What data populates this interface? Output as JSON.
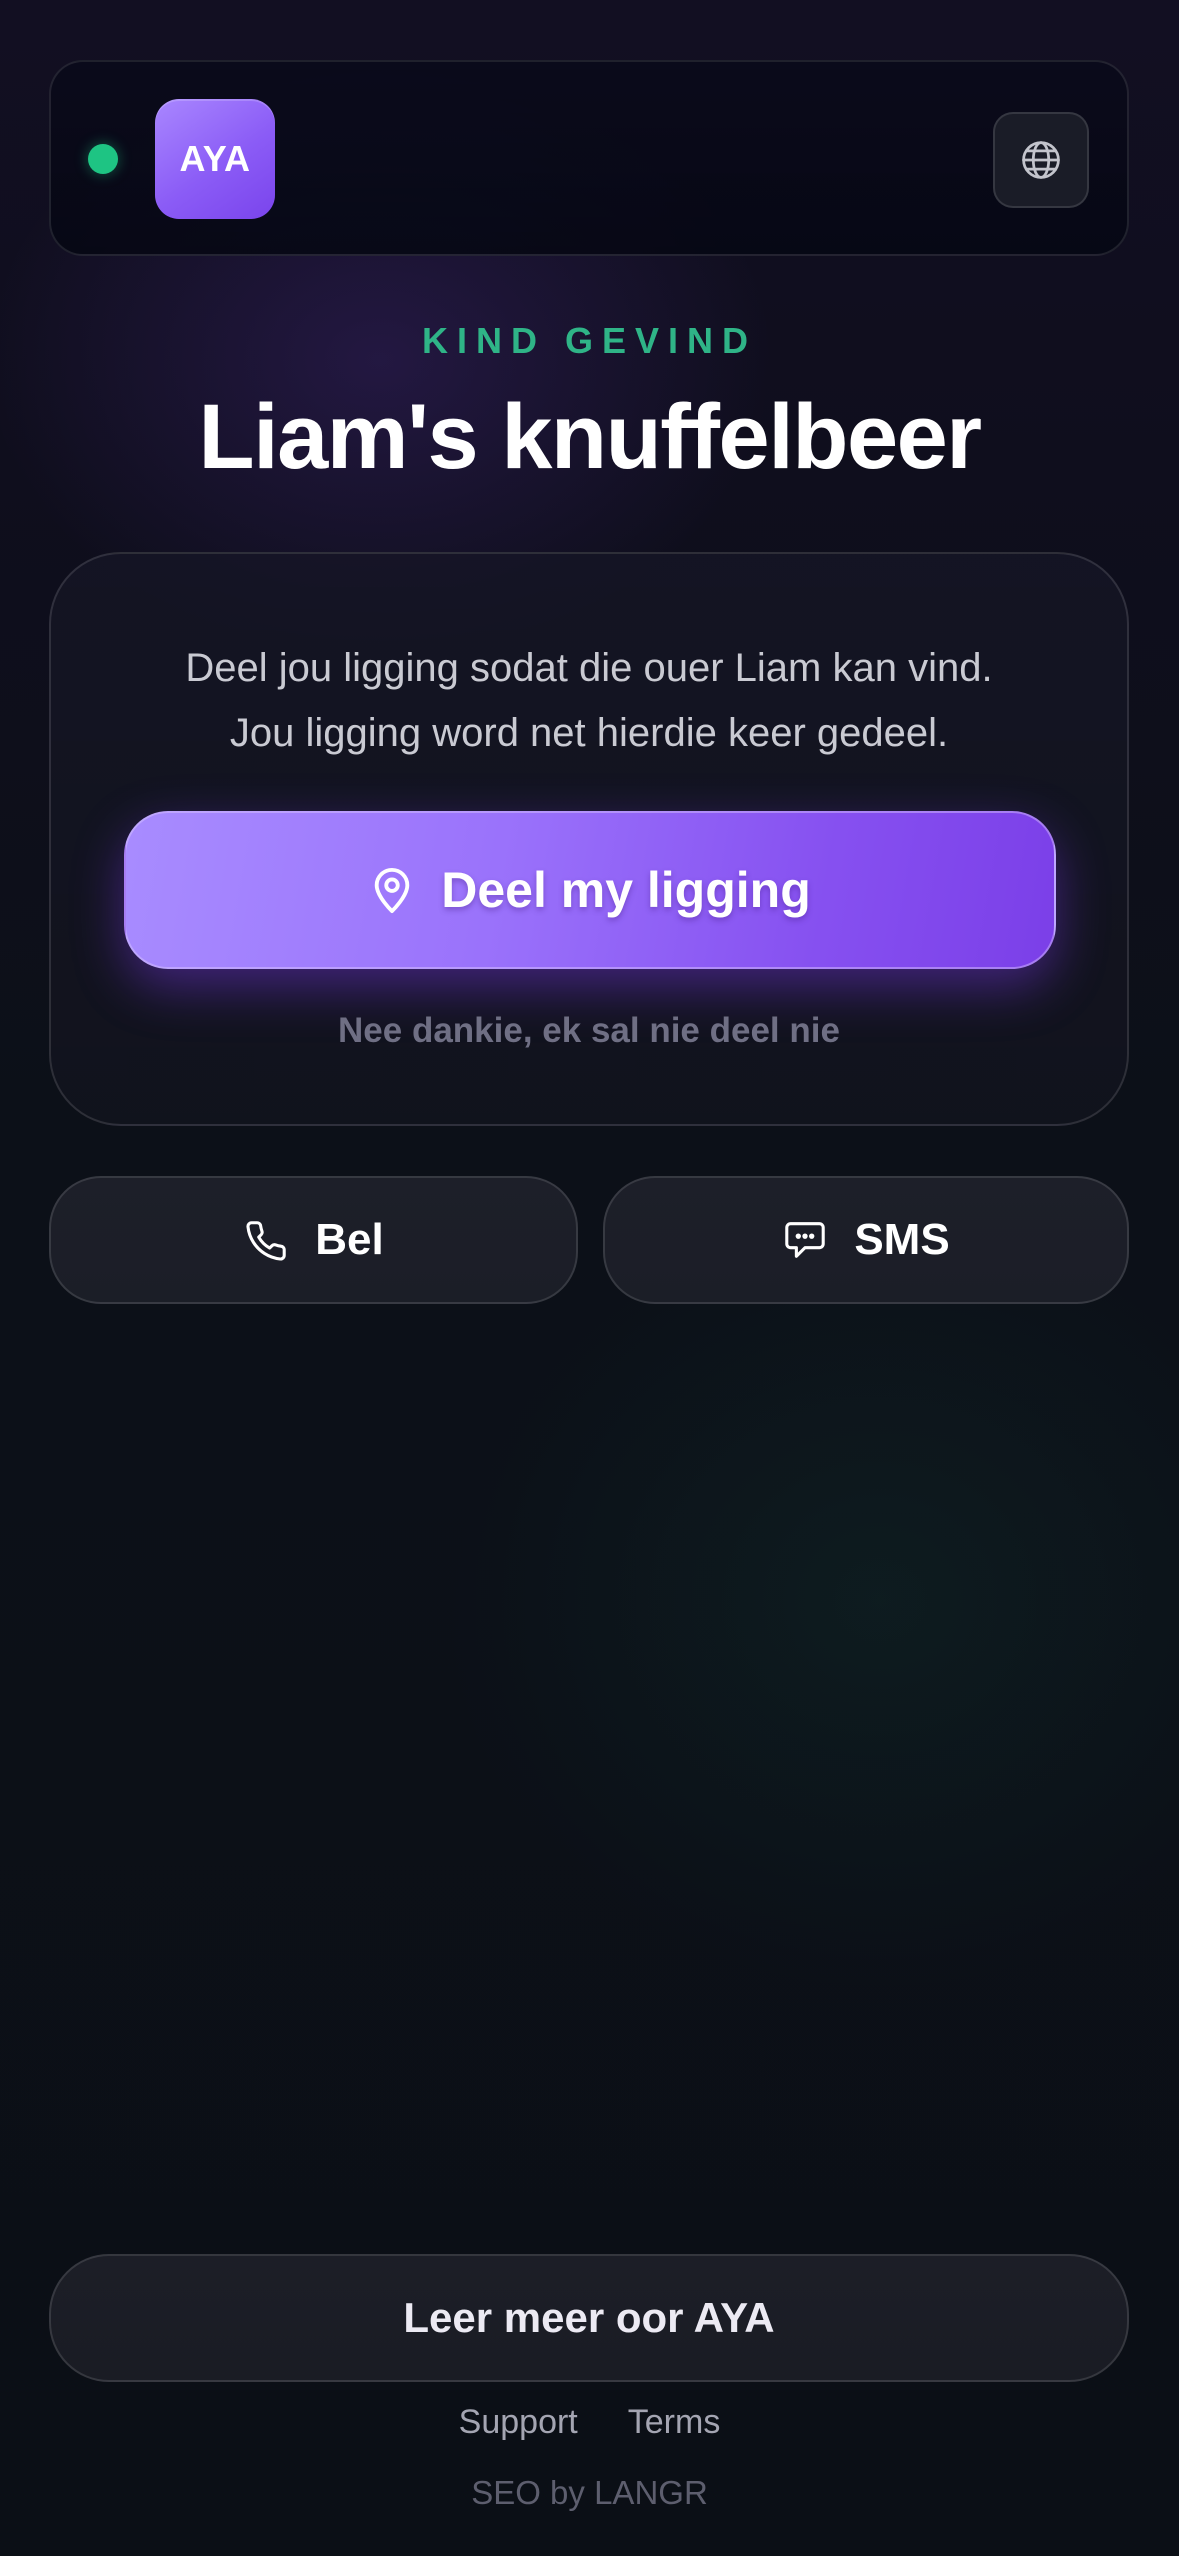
{
  "header": {
    "status": "online",
    "logo_text": "AYA",
    "globe_icon": "globe-icon"
  },
  "hero": {
    "eyebrow": "KIND GEVIND",
    "title": "Liam's knuffelbeer"
  },
  "card": {
    "message_line1": "Deel jou ligging sodat die ouer Liam kan vind.",
    "message_line2": "Jou ligging word net hierdie keer gedeel.",
    "share_button_label": "Deel my ligging",
    "share_button_icon": "map-pin-icon",
    "decline_label": "Nee dankie, ek sal nie deel nie"
  },
  "actions": {
    "call_label": "Bel",
    "call_icon": "phone-icon",
    "sms_label": "SMS",
    "sms_icon": "message-icon"
  },
  "footer": {
    "learn_more_label": "Leer meer oor AYA",
    "links": [
      "Support",
      "Terms"
    ],
    "credit": "SEO by LANGR"
  },
  "colors": {
    "accent_purple": "#8b5cf6",
    "status_green": "#1ec483",
    "eyebrow_green": "#2fb487",
    "background": "#0c1018"
  }
}
